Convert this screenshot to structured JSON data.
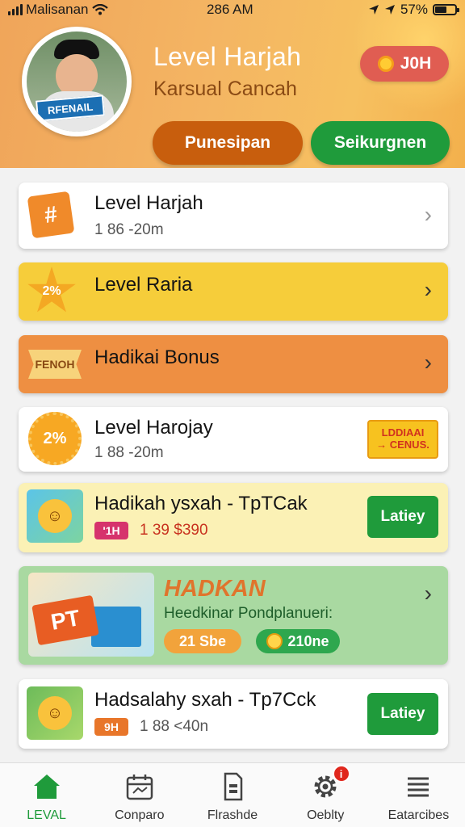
{
  "status_bar": {
    "carrier": "Malisanan",
    "time": "286 AM",
    "battery": "57%",
    "battery_level": 0.57
  },
  "header": {
    "title": "Level Harjah",
    "subtitle": "Karsual Cancah",
    "avatar_sign": "RFENAIL",
    "coins": "J0H",
    "button_primary": "Punesipan",
    "button_secondary": "Seikurgnen"
  },
  "cards": [
    {
      "title": "Level Harjah",
      "sub": "1 86 -20m",
      "icon_text": "#"
    },
    {
      "title": "Level Raria",
      "icon_text": "2%"
    },
    {
      "title": "Hadikai Bonus",
      "icon_text": "FENOH"
    },
    {
      "title": "Level Harojay",
      "sub": "1 88 -20m",
      "icon_text": "2%",
      "badge_line1": "LDDIAAI",
      "badge_line2": "→ CENUS."
    },
    {
      "title": "Hadikah ysxah - TpTCak",
      "tag": "'1H",
      "price": "1 39 $390",
      "action": "Latiey"
    },
    {
      "title": "HADKAN",
      "sub": "Heedkinar Pondplanueri:",
      "art_text": "PT",
      "pill1": "21 Sbe",
      "pill2": "210ne"
    },
    {
      "title": "Hadsalahy sxah - Tp7Cck",
      "tag": "9H",
      "price": "1 88 <40n",
      "action": "Latiey"
    }
  ],
  "nav": [
    {
      "label": "LEVAL",
      "icon": "home-icon",
      "active": true
    },
    {
      "label": "Conparo",
      "icon": "calendar-icon"
    },
    {
      "label": "Flrashde",
      "icon": "sim-icon"
    },
    {
      "label": "Oeblty",
      "icon": "gear-icon",
      "badge": "i"
    },
    {
      "label": "Eatarcibes",
      "icon": "menu-icon"
    }
  ],
  "colors": {
    "header_orange": "#f4b563",
    "accent_green": "#1f9b3b",
    "accent_orange": "#c85e0d",
    "card_yellow": "#f6cd3a",
    "card_orange": "#ee8f42",
    "card_cream": "#fbf1b5",
    "card_mint": "#a9d9a1"
  }
}
